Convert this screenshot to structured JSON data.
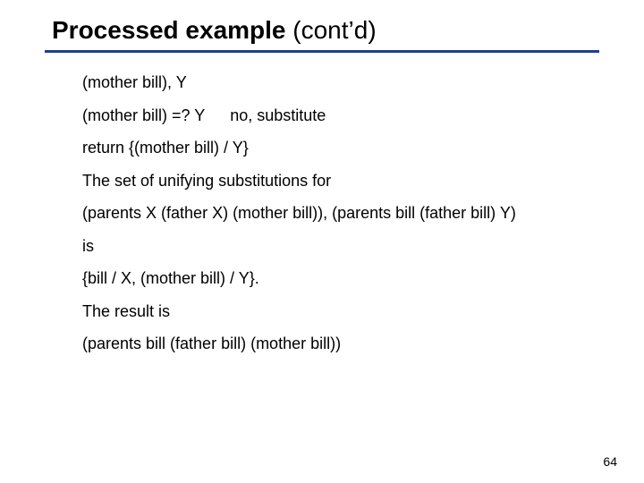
{
  "title_bold": "Processed example",
  "title_rest": " (cont’d)",
  "lines": {
    "l1": "(mother bill), Y",
    "l2a": "(mother bill) =? Y",
    "l2b": "no, substitute",
    "l3": "return {(mother bill) / Y}",
    "l4": "The set of unifying substitutions for",
    "l5": "(parents X (father X) (mother bill)), (parents bill (father bill) Y)",
    "l6": "is",
    "l7": "{bill / X, (mother bill) / Y}.",
    "l8": "The result is",
    "l9": "(parents bill (father bill) (mother bill))"
  },
  "page_number": "64"
}
